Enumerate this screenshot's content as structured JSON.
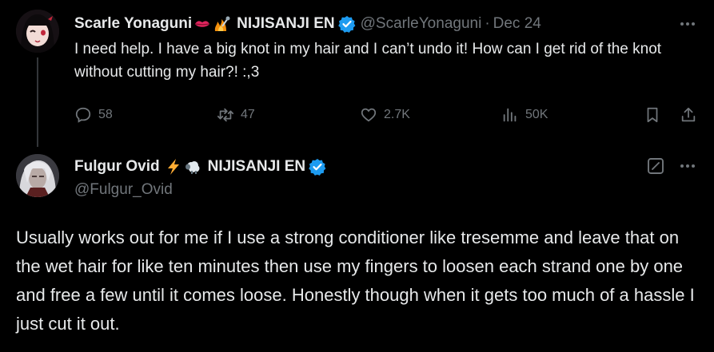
{
  "tweet1": {
    "display_name": "Scarle Yonaguni",
    "emoji_names": [
      "lips-emoji",
      "fire-mic-emoji"
    ],
    "affiliation": "NIJISANJI EN",
    "handle": "@ScarleYonaguni",
    "separator": "·",
    "date": "Dec 24",
    "text": "I need help. I have a big knot in my hair and I can’t undo it! How can I get rid of the knot without cutting my hair?! :,3",
    "actions": {
      "replies": "58",
      "reposts": "47",
      "likes": "2.7K",
      "views": "50K"
    }
  },
  "tweet2": {
    "display_name": "Fulgur Ovid",
    "emoji_names": [
      "lightning-emoji",
      "sheep-emoji"
    ],
    "affiliation": "NIJISANJI EN",
    "handle": "@Fulgur_Ovid",
    "text": "Usually works out for me if I use a strong conditioner like tresemme and leave that on the wet hair for like ten minutes then use my fingers to loosen each strand one by one and free a few until it comes loose. Honestly though when it gets too much of a hassle I just cut it out."
  },
  "colors": {
    "background": "#000000",
    "text": "#e7e9ea",
    "muted": "#71767b",
    "verified": "#1d9bf0",
    "divider": "#333639"
  }
}
